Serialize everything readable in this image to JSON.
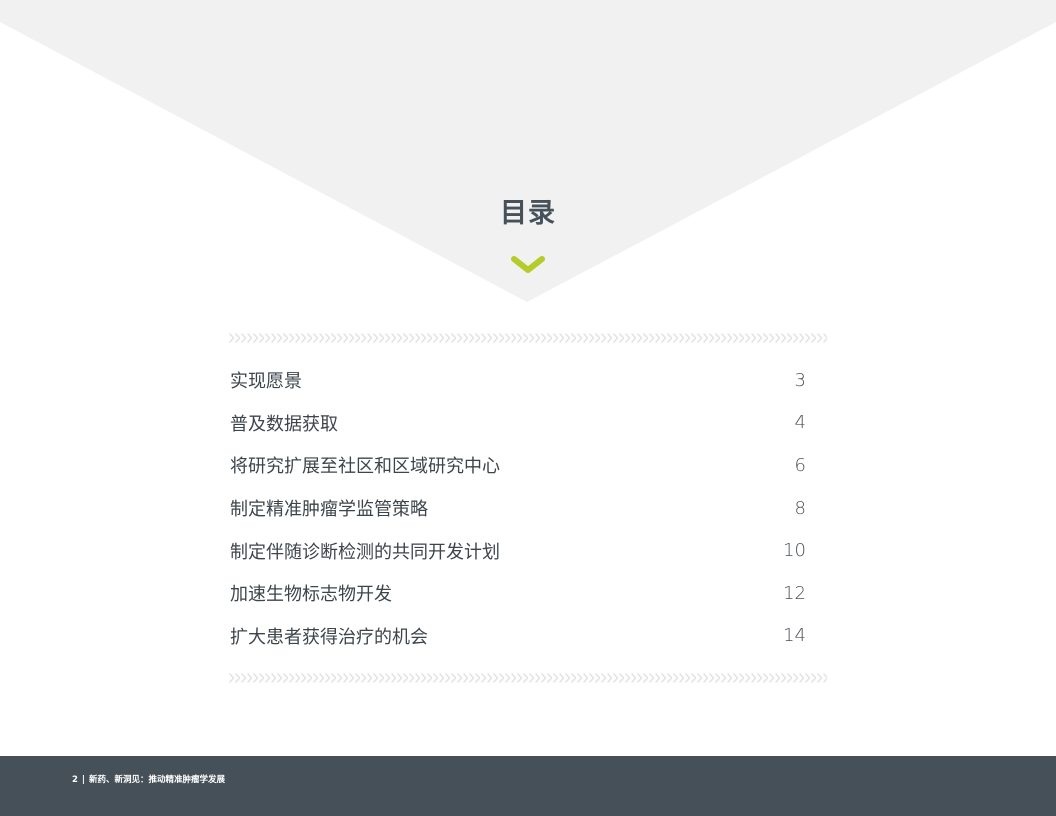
{
  "page": {
    "title": "目录"
  },
  "colors": {
    "background_shape": "#f0f1f0",
    "accent": "#b5cc2b",
    "divider": "#e2e4e2",
    "title": "#46515a",
    "footer": "#465059"
  },
  "icons": {
    "title_marker": "chevron-down-icon",
    "divider_pattern": "chevron-right-icon"
  },
  "toc": {
    "items": [
      {
        "label": "实现愿景",
        "page": "3"
      },
      {
        "label": "普及数据获取",
        "page": "4"
      },
      {
        "label": "将研究扩展至社区和区域研究中心",
        "page": "6"
      },
      {
        "label": "制定精准肿瘤学监管策略",
        "page": "8"
      },
      {
        "label": "制定伴随诊断检测的共同开发计划",
        "page": "10"
      },
      {
        "label": "加速生物标志物开发",
        "page": "12"
      },
      {
        "label": "扩大患者获得治疗的机会",
        "page": "14"
      }
    ]
  },
  "footer": {
    "page_number": "2",
    "separator": "|",
    "publication": "新药、新洞见：推动精准肿瘤学发展"
  }
}
